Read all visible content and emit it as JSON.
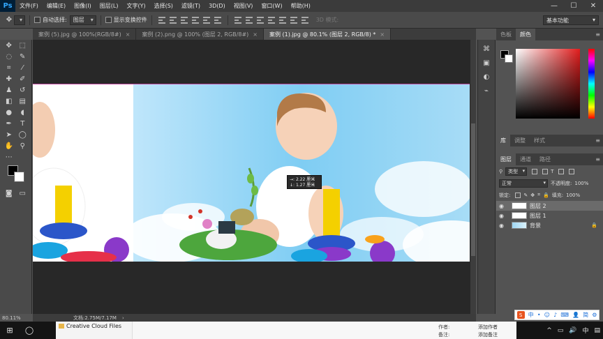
{
  "app": {
    "logo": "Ps"
  },
  "menu": [
    "文件(F)",
    "编辑(E)",
    "图像(I)",
    "图层(L)",
    "文字(Y)",
    "选择(S)",
    "滤镜(T)",
    "3D(D)",
    "视图(V)",
    "窗口(W)",
    "帮助(H)"
  ],
  "window_controls": {
    "minimize": "—",
    "maximize": "☐",
    "close": "✕"
  },
  "options": {
    "auto_select_label": "自动选择:",
    "auto_select_value": "图层",
    "show_transform_label": "显示变换控件",
    "mode_3d_label": "3D 模式:",
    "workspace": "基本功能"
  },
  "tabs": [
    {
      "label": "案例 (5).jpg @ 100%(RGB/8#)",
      "close": "×"
    },
    {
      "label": "案例 (2).png @ 100% (图层 2, RGB/8#)",
      "close": "×"
    },
    {
      "label": "案例 (1).jpg @ 80.1% (图层 2, RGB/8) *",
      "close": "×"
    }
  ],
  "measure": {
    "width": "→: 2.22 厘米",
    "height": "↓: 1.27 厘米"
  },
  "status": {
    "zoom": "80.11%",
    "doc_size": "文档:2.75M/7.17M",
    "arrow": "›"
  },
  "panels": {
    "color_tabs": [
      "色板",
      "颜色"
    ],
    "library_tabs": [
      "库",
      "调整",
      "样式"
    ],
    "layers_tabs": [
      "图层",
      "通道",
      "路径"
    ],
    "filter_kind": "类型",
    "blend_mode": "正常",
    "opacity_label": "不透明度:",
    "opacity_value": "100%",
    "lock_label": "锁定:",
    "fill_label": "填充:",
    "fill_value": "100%",
    "layers": [
      {
        "name": "图层 2",
        "selected": true
      },
      {
        "name": "图层 1",
        "selected": false
      },
      {
        "name": "背景",
        "selected": false,
        "locked": true
      }
    ]
  },
  "explorer": {
    "cc_files": "Creative Cloud Files",
    "author_label": "作者:",
    "author_value": "添加作者",
    "note_label": "备注:",
    "note_value": "添加备注"
  },
  "ime": {
    "logo": "S",
    "items": [
      "中",
      "•",
      "☺",
      "♪",
      "⌨",
      "👤",
      "简",
      "⚙"
    ]
  },
  "tray": [
    "^",
    "▭",
    "🔊",
    "中",
    "▤"
  ],
  "colors": {
    "accent_selection": "#c04aa0",
    "ps_blue": "#31a8ff"
  }
}
